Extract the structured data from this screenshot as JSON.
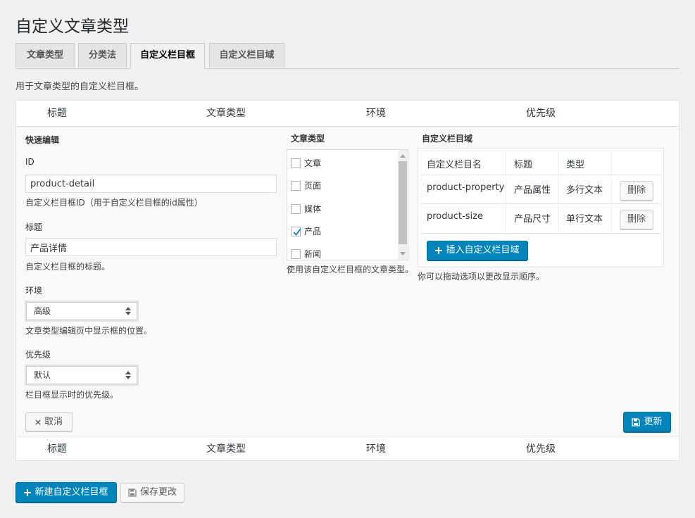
{
  "page_title": "自定义文章类型",
  "tabs": [
    {
      "label": "文章类型"
    },
    {
      "label": "分类法"
    },
    {
      "label": "自定义栏目框"
    },
    {
      "label": "自定义栏目域"
    }
  ],
  "description": "用于文章类型的自定义栏目框。",
  "columns": {
    "title": "标题",
    "post_type": "文章类型",
    "context": "环境",
    "priority": "优先级"
  },
  "quick_edit": {
    "heading": "快速编辑",
    "id_label": "ID",
    "id_value": "product-detail",
    "id_help": "自定义栏目框ID（用于自定义栏目框的id属性）",
    "title_label": "标题",
    "title_value": "产品详情",
    "title_help": "自定义栏目框的标题。",
    "context_label": "环境",
    "context_value": "高级",
    "context_help": "文章类型编辑页中显示框的位置。",
    "priority_label": "优先级",
    "priority_value": "默认",
    "priority_help": "栏目框显示时的优先级。"
  },
  "post_types": {
    "heading": "文章类型",
    "items": [
      {
        "label": "文章",
        "checked": false
      },
      {
        "label": "页面",
        "checked": false
      },
      {
        "label": "媒体",
        "checked": false
      },
      {
        "label": "产品",
        "checked": true
      },
      {
        "label": "新闻",
        "checked": false
      }
    ],
    "help": "使用该自定义栏目框的文章类型。"
  },
  "fields": {
    "heading": "自定义栏目域",
    "col_name": "自定义栏目名",
    "col_title": "标题",
    "col_type": "类型",
    "rows": [
      {
        "name": "product-property",
        "title": "产品属性",
        "type": "多行文本",
        "delete": "删除"
      },
      {
        "name": "product-size",
        "title": "产品尺寸",
        "type": "单行文本",
        "delete": "删除"
      }
    ],
    "insert_button": "插入自定义栏目域",
    "help": "你可以拖动选项以更改显示顺序。"
  },
  "cancel_button": "取消",
  "update_button": "更新",
  "new_button": "新建自定义栏目框",
  "save_button": "保存更改",
  "colors": {
    "primary": "#0085ba",
    "check": "#1e8cbe"
  }
}
